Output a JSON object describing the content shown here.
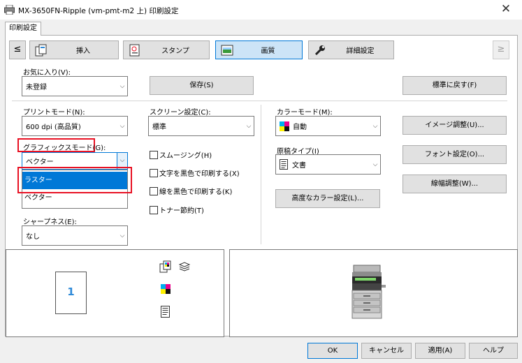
{
  "window": {
    "title": "MX-3650FN-Ripple (vm-pmt-m2 上) 印刷設定",
    "close_glyph": "✕"
  },
  "tab": {
    "label": "印刷設定"
  },
  "nav": {
    "prev_glyph": "≤",
    "next_glyph": "≥",
    "tabs": [
      {
        "label": "挿入",
        "icon": "insert-pages-icon"
      },
      {
        "label": "スタンプ",
        "icon": "stamp-icon"
      },
      {
        "label": "画質",
        "icon": "image-quality-icon",
        "active": true
      },
      {
        "label": "詳細設定",
        "icon": "wrench-icon"
      }
    ]
  },
  "favorites": {
    "label": "お気に入り(V):",
    "value": "未登録",
    "save_button": "保存(S)",
    "reset_button": "標準に戻す(F)"
  },
  "print_mode": {
    "label": "プリントモード(N):",
    "value": "600 dpi (高品質)"
  },
  "screen": {
    "label": "スクリーン設定(C):",
    "value": "標準"
  },
  "color_mode": {
    "label": "カラーモード(M):",
    "value": "自動"
  },
  "graphics_mode": {
    "label": "グラフィックスモード(G):",
    "value": "ベクター",
    "options": [
      "ラスター",
      "ベクター"
    ],
    "highlighted_option": "ラスター"
  },
  "checkboxes": {
    "smoothing": "スムージング(H)",
    "text_black": "文字を黒色で印刷する(X)",
    "line_black": "線を黒色で印刷する(K)",
    "toner_save": "トナー節約(T)"
  },
  "doc_type": {
    "label": "原稿タイプ(I)",
    "value": "文書"
  },
  "advanced_color_button": "高度なカラー設定(L)...",
  "right_buttons": {
    "image_adjust": "イメージ調整(U)...",
    "font_settings": "フォント設定(O)...",
    "line_width": "線幅調整(W)..."
  },
  "sharpness": {
    "label": "シャープネス(E):",
    "value": "なし"
  },
  "preview": {
    "page_number": "1"
  },
  "footer": {
    "ok": "OK",
    "cancel": "キャンセル",
    "apply": "適用(A)",
    "help": "ヘルプ"
  },
  "colors": {
    "accent": "#0078d7",
    "highlight_border": "#e81123"
  }
}
